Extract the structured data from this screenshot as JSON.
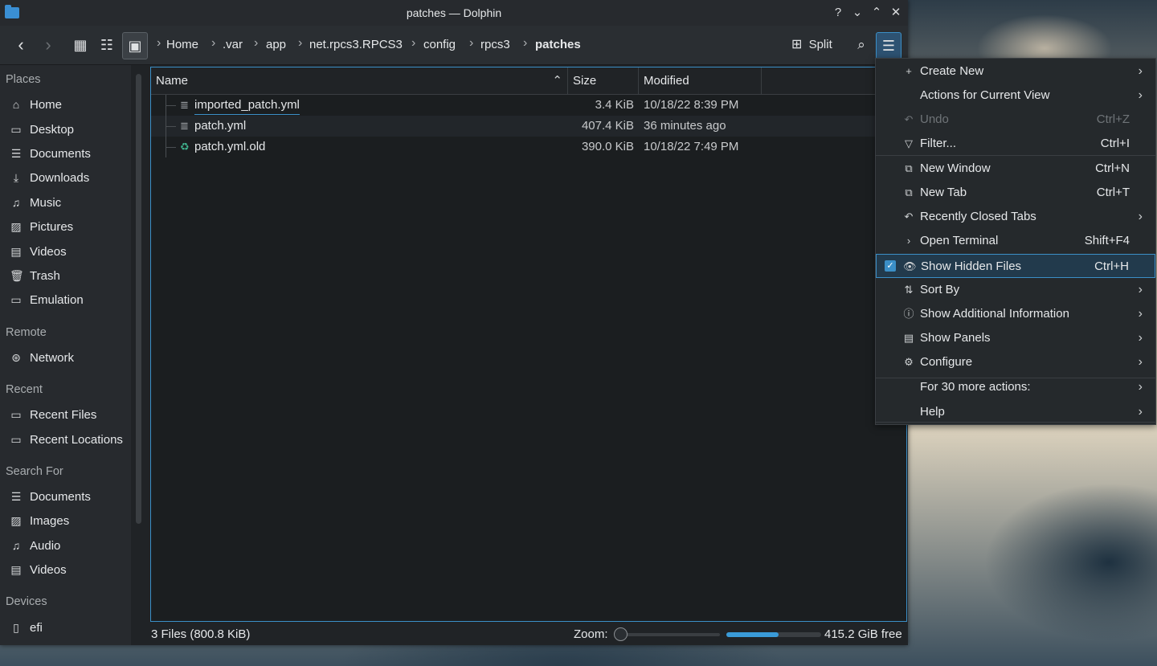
{
  "window": {
    "title": "patches — Dolphin"
  },
  "titlebar_buttons": {
    "help": "?",
    "minimize": "⌄",
    "maximize": "⌃",
    "close": "✕"
  },
  "toolbar": {
    "breadcrumbs": [
      "Home",
      ".var",
      "app",
      "net.rpcs3.RPCS3",
      "config",
      "rpcs3",
      "patches"
    ],
    "split_label": "Split"
  },
  "sidebar": {
    "sections": [
      {
        "title": "Places",
        "items": [
          {
            "label": "Home",
            "icon": "home-icon"
          },
          {
            "label": "Desktop",
            "icon": "desktop-icon"
          },
          {
            "label": "Documents",
            "icon": "documents-icon"
          },
          {
            "label": "Downloads",
            "icon": "downloads-icon"
          },
          {
            "label": "Music",
            "icon": "music-icon"
          },
          {
            "label": "Pictures",
            "icon": "pictures-icon"
          },
          {
            "label": "Videos",
            "icon": "videos-icon"
          },
          {
            "label": "Trash",
            "icon": "trash-icon"
          },
          {
            "label": "Emulation",
            "icon": "folder-icon"
          }
        ]
      },
      {
        "title": "Remote",
        "items": [
          {
            "label": "Network",
            "icon": "network-icon"
          }
        ]
      },
      {
        "title": "Recent",
        "items": [
          {
            "label": "Recent Files",
            "icon": "recent-files-icon"
          },
          {
            "label": "Recent Locations",
            "icon": "recent-locations-icon"
          }
        ]
      },
      {
        "title": "Search For",
        "items": [
          {
            "label": "Documents",
            "icon": "documents-icon"
          },
          {
            "label": "Images",
            "icon": "images-icon"
          },
          {
            "label": "Audio",
            "icon": "audio-icon"
          },
          {
            "label": "Videos",
            "icon": "videos-icon"
          }
        ]
      },
      {
        "title": "Devices",
        "items": [
          {
            "label": "efi",
            "icon": "drive-icon"
          }
        ]
      }
    ]
  },
  "columns": {
    "name": "Name",
    "size": "Size",
    "modified": "Modified"
  },
  "files": [
    {
      "name": "imported_patch.yml",
      "size": "3.4 KiB",
      "modified": "10/18/22 8:39 PM"
    },
    {
      "name": "patch.yml",
      "size": "407.4 KiB",
      "modified": "36 minutes ago"
    },
    {
      "name": "patch.yml.old",
      "size": "390.0 KiB",
      "modified": "10/18/22 7:49 PM"
    }
  ],
  "status": {
    "text": "3 Files (800.8 KiB)",
    "zoom_label": "Zoom:",
    "free_space": "415.2 GiB free",
    "zoom_level": 0.0,
    "disk_used_fraction": 0.55
  },
  "menu": {
    "items": [
      {
        "label": "Create New",
        "shortcut": "",
        "submenu": true,
        "icon": "+"
      },
      {
        "label": "Actions for Current View",
        "shortcut": "",
        "submenu": true,
        "icon": ""
      },
      {
        "label": "Undo",
        "shortcut": "Ctrl+Z",
        "submenu": false,
        "icon": "↶",
        "disabled": true
      },
      {
        "label": "Filter...",
        "shortcut": "Ctrl+I",
        "submenu": false,
        "icon": "▽"
      },
      {
        "label": "New Window",
        "shortcut": "Ctrl+N",
        "submenu": false,
        "icon": "⧉"
      },
      {
        "label": "New Tab",
        "shortcut": "Ctrl+T",
        "submenu": false,
        "icon": "⧉"
      },
      {
        "label": "Recently Closed Tabs",
        "shortcut": "",
        "submenu": true,
        "icon": "↶"
      },
      {
        "label": "Open Terminal",
        "shortcut": "Shift+F4",
        "submenu": false,
        "icon": "›"
      },
      {
        "label": "Show Hidden Files",
        "shortcut": "Ctrl+H",
        "submenu": false,
        "icon": "👁",
        "checked": true
      },
      {
        "label": "Sort By",
        "shortcut": "",
        "submenu": true,
        "icon": "⇅"
      },
      {
        "label": "Show Additional Information",
        "shortcut": "",
        "submenu": true,
        "icon": "ⓘ"
      },
      {
        "label": "Show Panels",
        "shortcut": "",
        "submenu": true,
        "icon": "▤"
      },
      {
        "label": "Configure",
        "shortcut": "",
        "submenu": true,
        "icon": "⚙"
      },
      {
        "label": "For 30 more actions:",
        "shortcut": "",
        "submenu": true,
        "icon": ""
      },
      {
        "label": "Help",
        "shortcut": "",
        "submenu": true,
        "icon": ""
      }
    ]
  }
}
